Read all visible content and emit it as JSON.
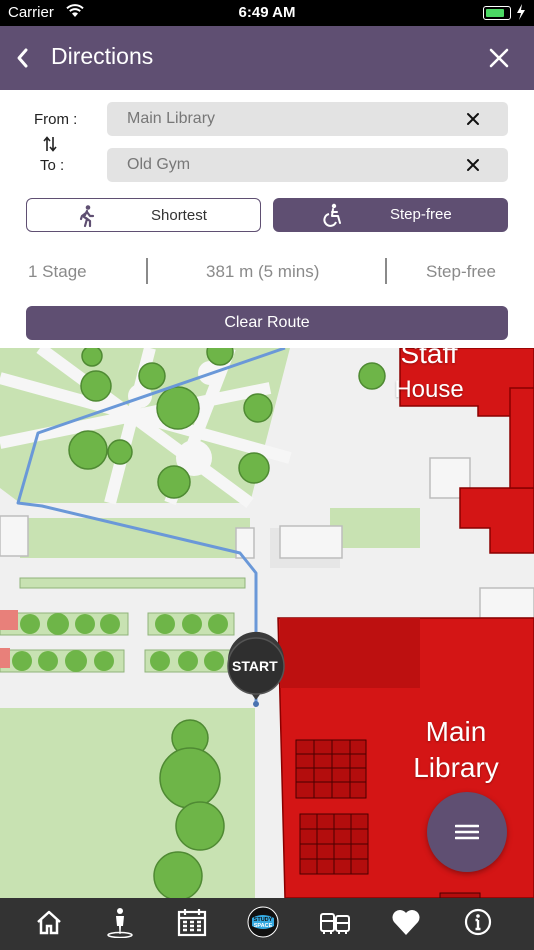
{
  "status_bar": {
    "carrier": "Carrier",
    "time": "6:49 AM"
  },
  "header": {
    "title": "Directions"
  },
  "route_form": {
    "from_label": "From :",
    "to_label": "To :",
    "from_value": "Main Library",
    "to_value": "Old Gym"
  },
  "modes": {
    "shortest_label": "Shortest",
    "stepfree_label": "Step-free",
    "selected": "Step-free"
  },
  "summary": {
    "stages": "1 Stage",
    "distance_time": "381 m (5 mins)",
    "type": "Step-free"
  },
  "clear_label": "Clear Route",
  "map": {
    "buildings": [
      {
        "name_line1": "Main",
        "name_line2": "Library"
      },
      {
        "name_line1": "Staff",
        "name_line2": "House"
      }
    ],
    "marker_label": "START"
  },
  "colors": {
    "brand": "#5f4f72",
    "building": "#d41515",
    "route": "#6a98d8",
    "lawn": "#c8e2b2"
  },
  "tabs": [
    {
      "icon": "home-icon"
    },
    {
      "icon": "person-location-icon"
    },
    {
      "icon": "calendar-icon"
    },
    {
      "icon": "study-space-icon",
      "text": "STUDY SPACE"
    },
    {
      "icon": "bus-icon"
    },
    {
      "icon": "heart-icon"
    },
    {
      "icon": "info-icon"
    }
  ]
}
